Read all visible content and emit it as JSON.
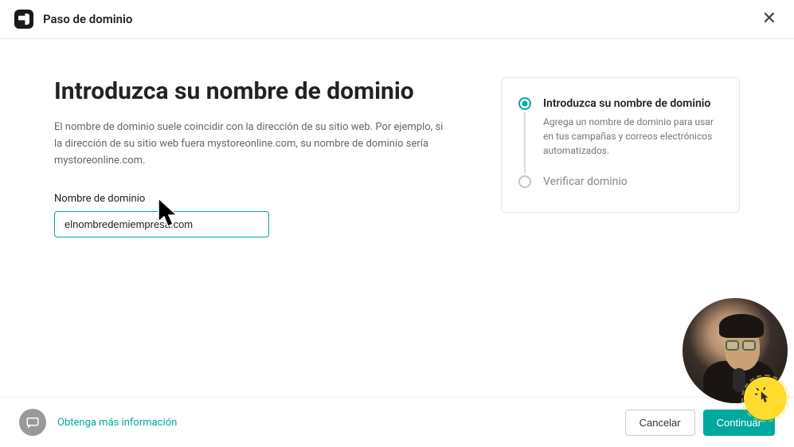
{
  "header": {
    "title": "Paso de dominio"
  },
  "main": {
    "heading": "Introduzca su nombre de dominio",
    "description": "El nombre de dominio suele coincidir con la dirección de su sitio web. Por ejemplo, si la dirección de su sitio web fuera mystoreonline.com, su nombre de dominio sería mystoreonline.com.",
    "input_label": "Nombre de dominio",
    "input_value": "elnombredemiempresa.com"
  },
  "steps": [
    {
      "title": "Introduzca su nombre de dominio",
      "desc": "Agrega un nombre de dominio para usar en tus campañas y correos electrónicos automatizados.",
      "active": true
    },
    {
      "title": "Verificar dominio",
      "desc": "",
      "active": false
    }
  ],
  "footer": {
    "help_link": "Obtenga más información",
    "cancel": "Cancelar",
    "continue": "Continuar"
  },
  "colors": {
    "accent": "#00a99d",
    "badge": "#ffdb2e"
  }
}
